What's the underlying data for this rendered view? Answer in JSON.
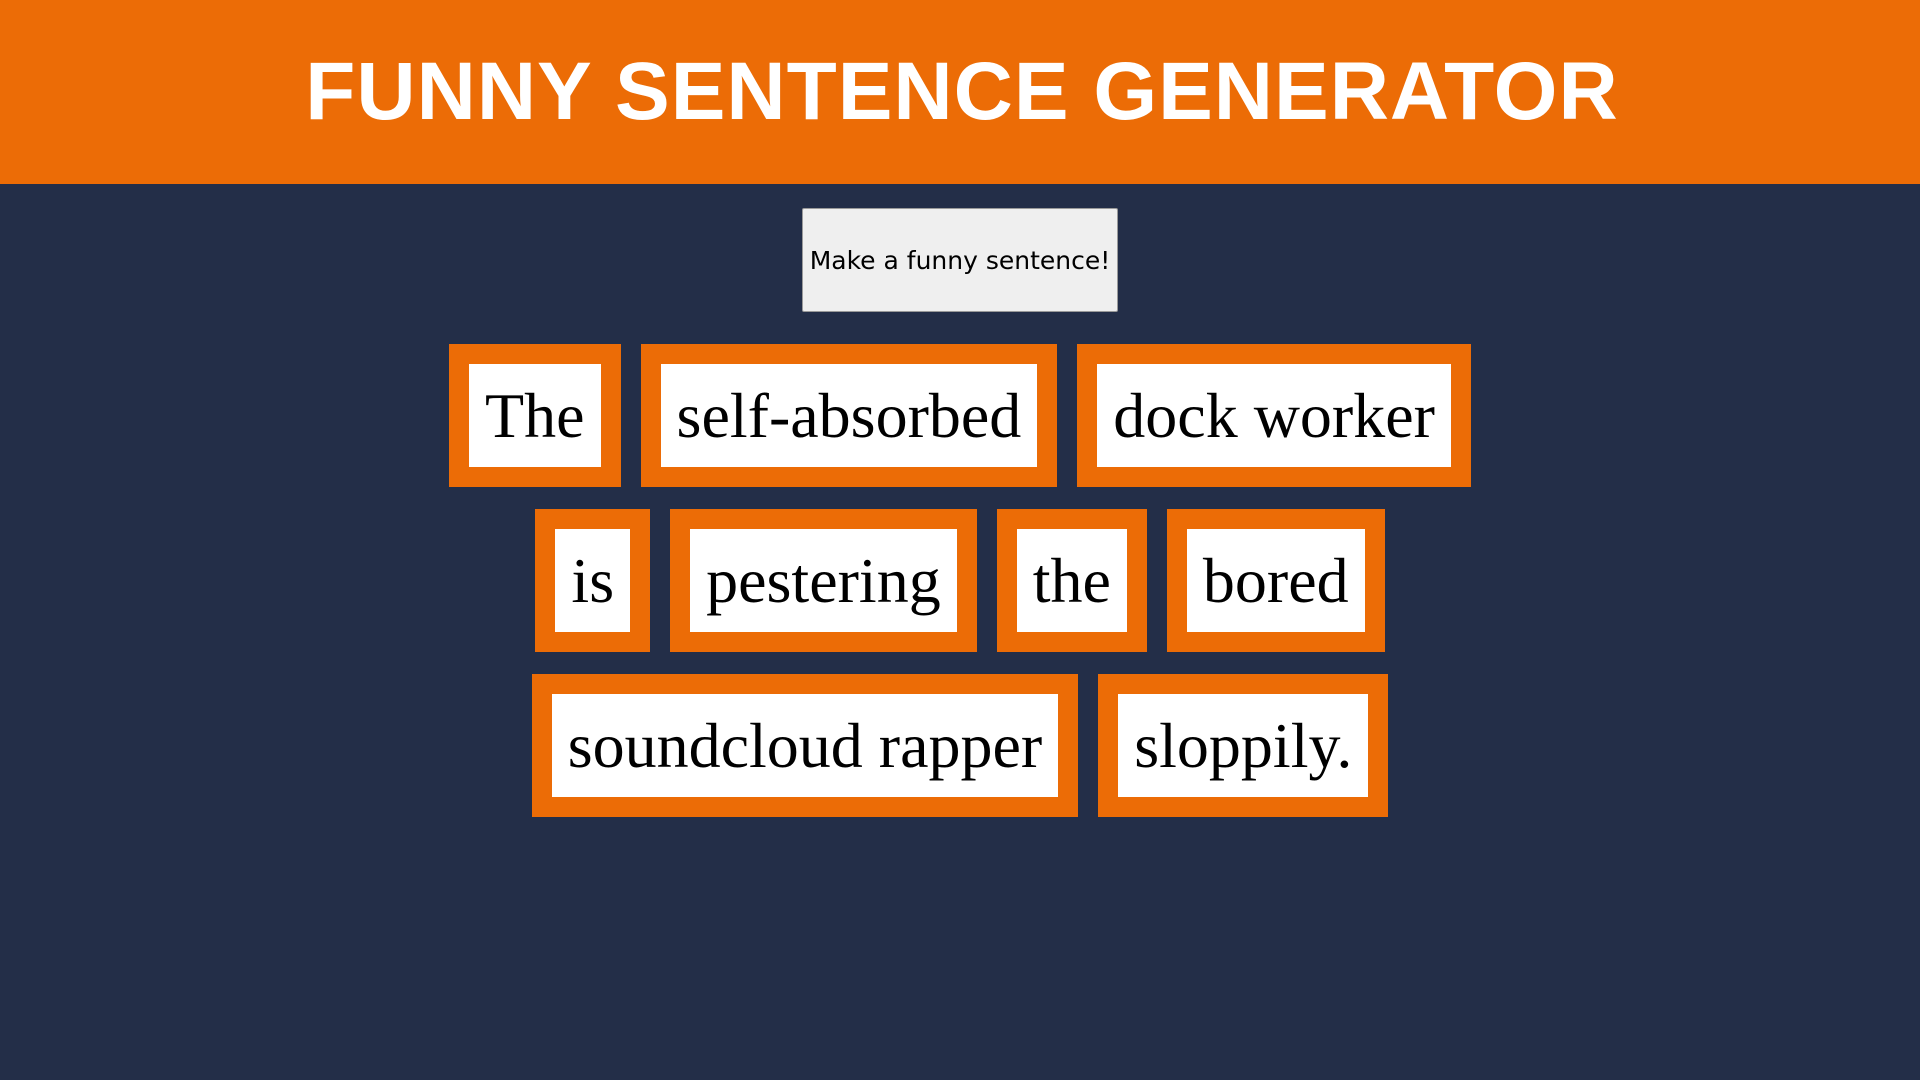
{
  "header": {
    "title": "FUNNY SENTENCE GENERATOR"
  },
  "controls": {
    "button_label": "Make a funny sentence!"
  },
  "sentence": {
    "rows": [
      [
        "The",
        "self-absorbed",
        "dock worker"
      ],
      [
        "is",
        "pestering",
        "the",
        "bored"
      ],
      [
        "soundcloud rapper",
        "sloppily."
      ]
    ]
  },
  "colors": {
    "accent": "#ec6c06",
    "background": "#232e48",
    "tile_inner": "#ffffff",
    "button": "#efefef"
  }
}
